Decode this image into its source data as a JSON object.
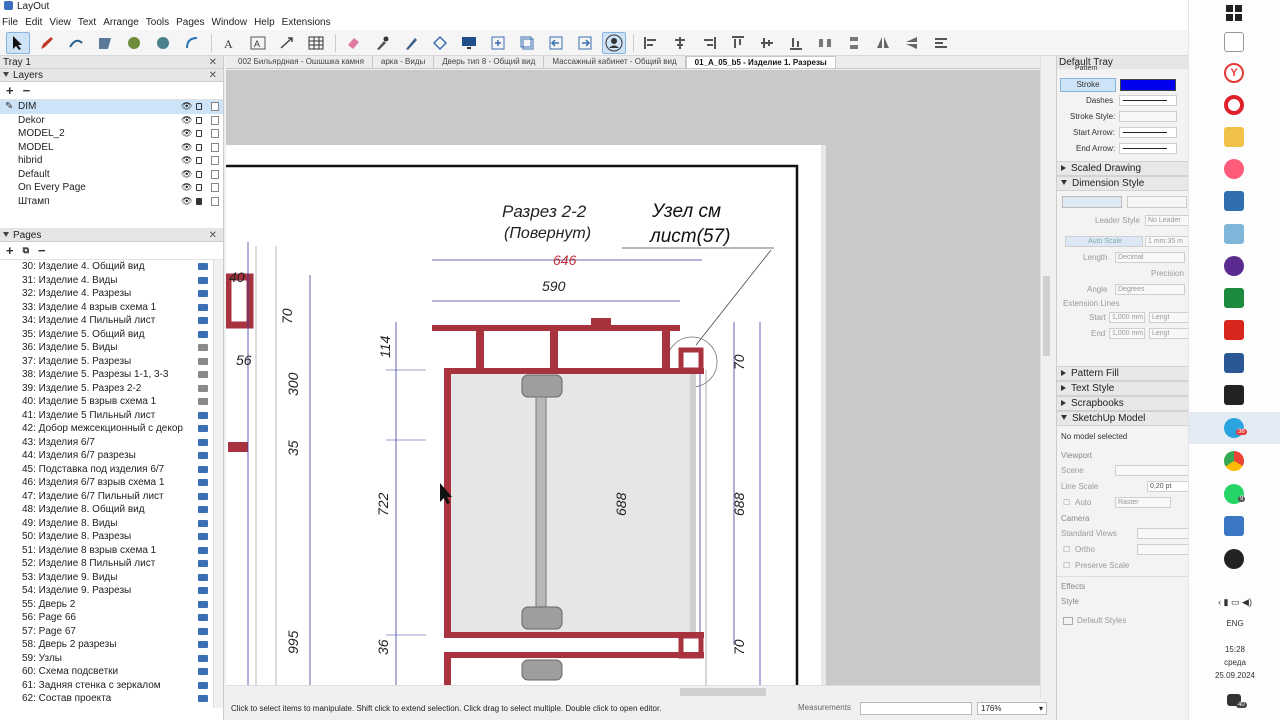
{
  "window": {
    "title": "LayOut"
  },
  "menu": [
    "File",
    "Edit",
    "View",
    "Text",
    "Arrange",
    "Tools",
    "Pages",
    "Window",
    "Help",
    "Extensions"
  ],
  "left_tray": {
    "title": "Tray 1",
    "layers_title": "Layers",
    "layers": [
      {
        "name": "DIM",
        "selected": true,
        "locked": false
      },
      {
        "name": "Dekor",
        "locked": false
      },
      {
        "name": "MODEL_2",
        "locked": false
      },
      {
        "name": "MODEL",
        "locked": false
      },
      {
        "name": "hibrid",
        "locked": false
      },
      {
        "name": "Default",
        "locked": false
      },
      {
        "name": "On Every Page",
        "locked": false
      },
      {
        "name": "Штамп",
        "locked": true
      }
    ],
    "pages_title": "Pages",
    "pages": [
      {
        "name": "30: Изделие 4. Общий вид",
        "grey": false
      },
      {
        "name": "31: Изделие 4. Виды",
        "grey": false
      },
      {
        "name": "32: Изделие 4. Разрезы",
        "grey": false
      },
      {
        "name": "33: Изделие 4 взрыв схема 1",
        "grey": false
      },
      {
        "name": "34: Изделие 4 Пильный лист",
        "grey": false
      },
      {
        "name": "35: Изделие 5. Общий вид",
        "grey": false
      },
      {
        "name": "36: Изделие 5. Виды",
        "grey": true
      },
      {
        "name": "37: Изделие 5. Разрезы",
        "grey": true
      },
      {
        "name": "38: Изделие 5. Разрезы 1-1, 3-3",
        "grey": true
      },
      {
        "name": "39: Изделие 5. Разрез 2-2",
        "grey": true
      },
      {
        "name": "40: Изделие 5 взрыв схема 1",
        "grey": true
      },
      {
        "name": "41: Изделие 5 Пильный лист",
        "grey": false
      },
      {
        "name": "42: Добор межсекционный с декор",
        "grey": false
      },
      {
        "name": "43: Изделия 6/7",
        "grey": false
      },
      {
        "name": "44: Изделия 6/7 разрезы",
        "grey": false
      },
      {
        "name": "45: Подставка под изделия 6/7",
        "grey": false
      },
      {
        "name": "46: Изделия 6/7 взрыв схема 1",
        "grey": false
      },
      {
        "name": "47: Изделие 6/7 Пильный лист",
        "grey": false
      },
      {
        "name": "48: Изделие 8. Общий вид",
        "grey": false
      },
      {
        "name": "49: Изделие 8. Виды",
        "grey": false
      },
      {
        "name": "50: Изделие 8. Разрезы",
        "grey": false
      },
      {
        "name": "51: Изделие 8 взрыв схема 1",
        "grey": false
      },
      {
        "name": "52: Изделие 8 Пильный лист",
        "grey": false
      },
      {
        "name": "53: Изделие 9. Виды",
        "grey": false
      },
      {
        "name": "54: Изделие 9. Разрезы",
        "grey": false
      },
      {
        "name": "55: Дверь 2",
        "grey": false
      },
      {
        "name": "56: Page 66",
        "grey": false
      },
      {
        "name": "57: Page 67",
        "grey": false
      },
      {
        "name": "58: Дверь 2 разрезы",
        "grey": false
      },
      {
        "name": "59: Узлы",
        "grey": false
      },
      {
        "name": "60: Схема подсветки",
        "grey": false
      },
      {
        "name": "61: Задняя стенка с зеркалом",
        "grey": false
      },
      {
        "name": "62: Состав проекта",
        "grey": false
      }
    ]
  },
  "doc_tabs": [
    {
      "label": "002 Бильярдная - Ошшшка камня",
      "active": false
    },
    {
      "label": "арка - Виды",
      "active": false
    },
    {
      "label": "Дверь тип 8 - Общий вид",
      "active": false
    },
    {
      "label": "Массажный кабинет - Общий вид",
      "active": false
    },
    {
      "label": "01_A_05_b5 - Изделие 1. Разрезы",
      "active": true
    }
  ],
  "drawing": {
    "section_title": "Разрез 2-2",
    "section_subtitle": "(Повернут)",
    "node_line1": "Узел см",
    "node_line2": "лист(57)",
    "dim_646": "646",
    "dim_590": "590",
    "dim_114": "114",
    "dim_70a": "70",
    "dim_70b": "70",
    "dim_70c": "70",
    "dim_40": "40",
    "dim_56": "56",
    "dim_300": "300",
    "dim_35": "35",
    "dim_722": "722",
    "dim_688a": "688",
    "dim_688b": "688",
    "dim_995": "995",
    "dim_36": "36",
    "colors": {
      "accent_red": "#a8323e",
      "dim_blue": "#3a3aa0",
      "dim_red": "#c0303a"
    }
  },
  "status": {
    "hint": "Click to select items to manipulate. Shift click to extend selection. Click drag to select multiple. Double click to open editor.",
    "measurements_label": "Measurements",
    "zoom": "176%"
  },
  "right_tray": {
    "title": "Default Tray",
    "pattern_label": "Pattern",
    "stroke_label": "Stroke",
    "stroke_color": "#0000ee",
    "dashes_label": "Dashes",
    "stroke_style_label": "Stroke Style:",
    "start_arrow_label": "Start Arrow:",
    "end_arrow_label": "End Arrow:",
    "scaled_drawing": "Scaled Drawing",
    "dimension_style": "Dimension Style",
    "leader_style_label": "Leader Style",
    "leader_style_value": "No Leader",
    "auto_scale": "Auto Scale",
    "scale_value": "1 mm:35 m",
    "length_label": "Length",
    "length_value": "Decimal",
    "precision_label": "Precision",
    "angle_label": "Angle",
    "angle_value": "Degrees",
    "extension_lines": "Extension Lines",
    "start_label": "Start",
    "start_value": "1,000 mm",
    "end_label": "End",
    "end_value": "1,000 mm",
    "length_short": "Lengt",
    "pattern_fill": "Pattern Fill",
    "text_style": "Text Style",
    "scrapbooks": "Scrapbooks",
    "sketchup_model": "SketchUp Model",
    "no_model": "No model selected",
    "viewport": "Viewport",
    "scene_label": "Scene",
    "line_scale_label": "Line Scale",
    "line_scale_value": "0,20 pt",
    "auto_label": "Auto",
    "raster_value": "Raster",
    "camera": "Camera",
    "standard_views": "Standard Views",
    "ortho": "Ortho",
    "preserve_scale": "Preserve Scale",
    "effects": "Effects",
    "style": "Style",
    "default_styles": "Default Styles"
  },
  "taskbar": {
    "lang": "ENG",
    "time": "15:28",
    "day": "среда",
    "date": "25.09.2024",
    "badge_telegram": "36",
    "badge_whatsapp": "9",
    "badge_notif": "40"
  }
}
